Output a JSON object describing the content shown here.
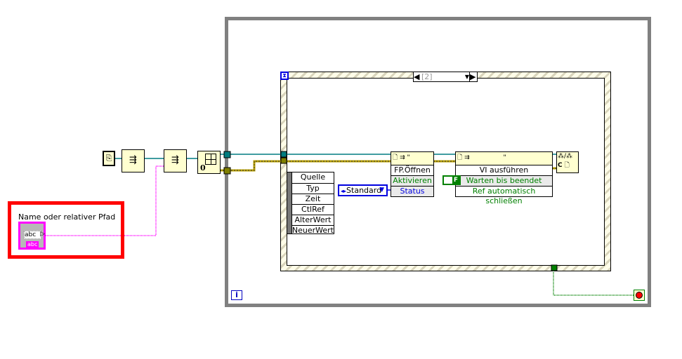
{
  "control": {
    "label": "Name oder relativer Pfad",
    "terminal_text": "abc",
    "type_text": "abc"
  },
  "sequence": {
    "selector": "[2]"
  },
  "event_data": [
    "Quelle",
    "Typ",
    "Zeit",
    "CtlRef",
    "AlterWert",
    "NeuerWert"
  ],
  "enum_constant": {
    "value": "Standard"
  },
  "property_node": {
    "title": "FP.Öffnen",
    "rows": [
      "Aktivieren",
      "Status"
    ]
  },
  "invoke_node": {
    "title": "VI ausführen",
    "rows": [
      "Warten bis beendet",
      "Ref automatisch schließen"
    ]
  },
  "bool_constant": {
    "value": "F"
  },
  "constant_zero": "0",
  "close_ref": {
    "text": "C"
  },
  "loop": {
    "iteration": "i"
  },
  "colors": {
    "refnum_wire": "#007c80",
    "error_wire": "#b8a000",
    "string_wire": "#ff00ff",
    "bool_wire": "#008000",
    "loop_border": "#808080",
    "highlight": "#ff0000"
  }
}
